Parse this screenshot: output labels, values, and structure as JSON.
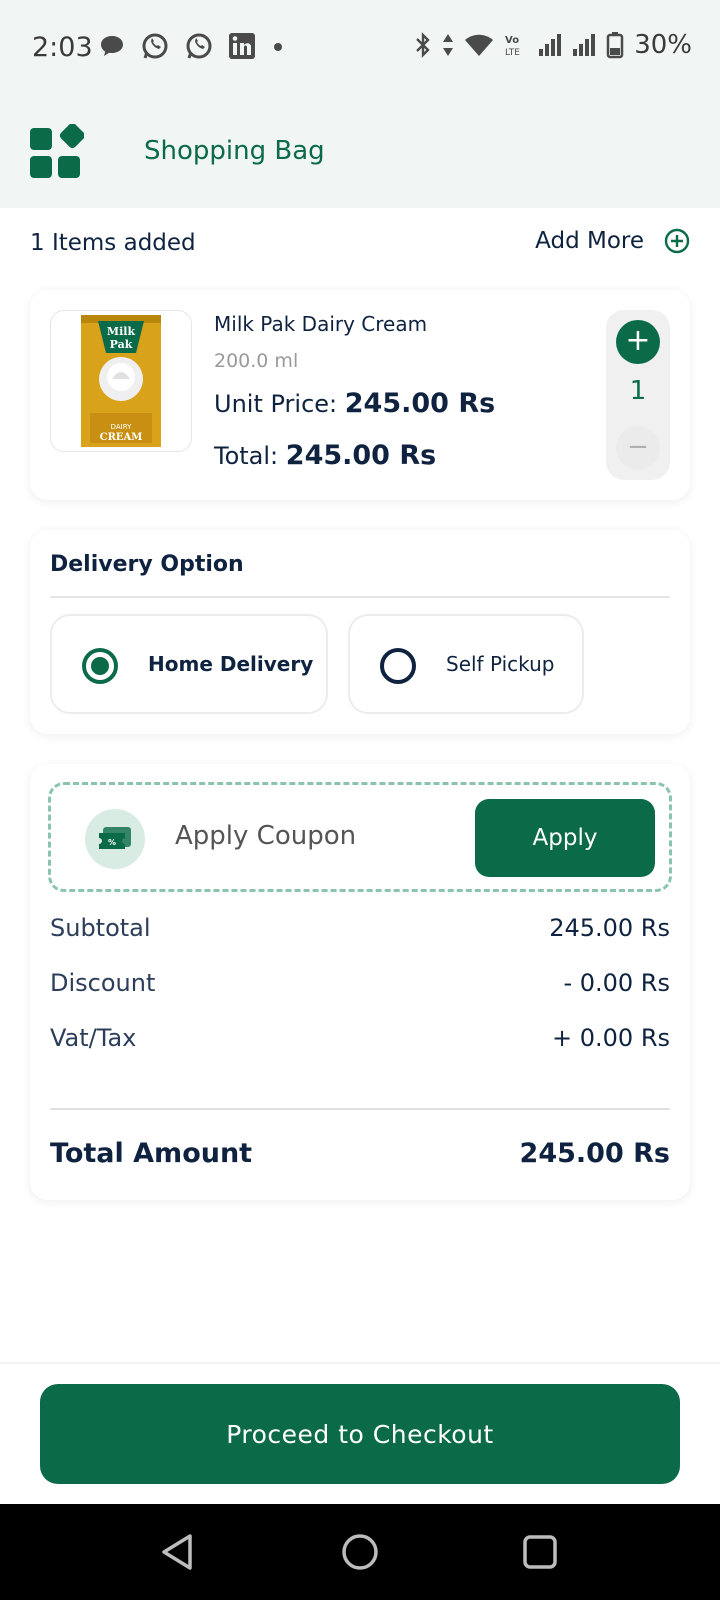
{
  "status_bar": {
    "time": "2:03",
    "battery": "30%",
    "icons": [
      "message-icon",
      "whatsapp-icon",
      "whatsapp-icon",
      "linkedin-icon",
      "dot-icon",
      "bluetooth-icon",
      "data-arrows-icon",
      "wifi-icon",
      "volte-icon",
      "signal-icon",
      "signal-icon",
      "battery-icon"
    ]
  },
  "header": {
    "title": "Shopping Bag",
    "logo": "app-grid-logo"
  },
  "cart": {
    "items_count_label": "1 Items added",
    "add_more_label": "Add More",
    "items": [
      {
        "name": "Milk Pak Dairy Cream",
        "size": "200.0 ml",
        "unit_price_label": "Unit Price:",
        "unit_price": "245.00 Rs",
        "total_label": "Total:",
        "total": "245.00 Rs",
        "quantity": "1",
        "image": "milk-pak-cream-pack"
      }
    ]
  },
  "delivery": {
    "title": "Delivery Option",
    "options": [
      {
        "label": "Home Delivery",
        "selected": true
      },
      {
        "label": "Self Pickup",
        "selected": false
      }
    ]
  },
  "coupon": {
    "placeholder": "Apply Coupon",
    "apply_label": "Apply"
  },
  "summary": {
    "subtotal_label": "Subtotal",
    "subtotal": "245.00 Rs",
    "discount_label": "Discount",
    "discount": "- 0.00 Rs",
    "tax_label": "Vat/Tax",
    "tax": "+ 0.00 Rs",
    "total_label": "Total Amount",
    "total": "245.00 Rs"
  },
  "checkout": {
    "label": "Proceed to Checkout"
  },
  "colors": {
    "primary": "#0b6b49",
    "text": "#0f2340",
    "header_bg": "#f1f5f4",
    "coupon_border": "#8bc4ad"
  }
}
